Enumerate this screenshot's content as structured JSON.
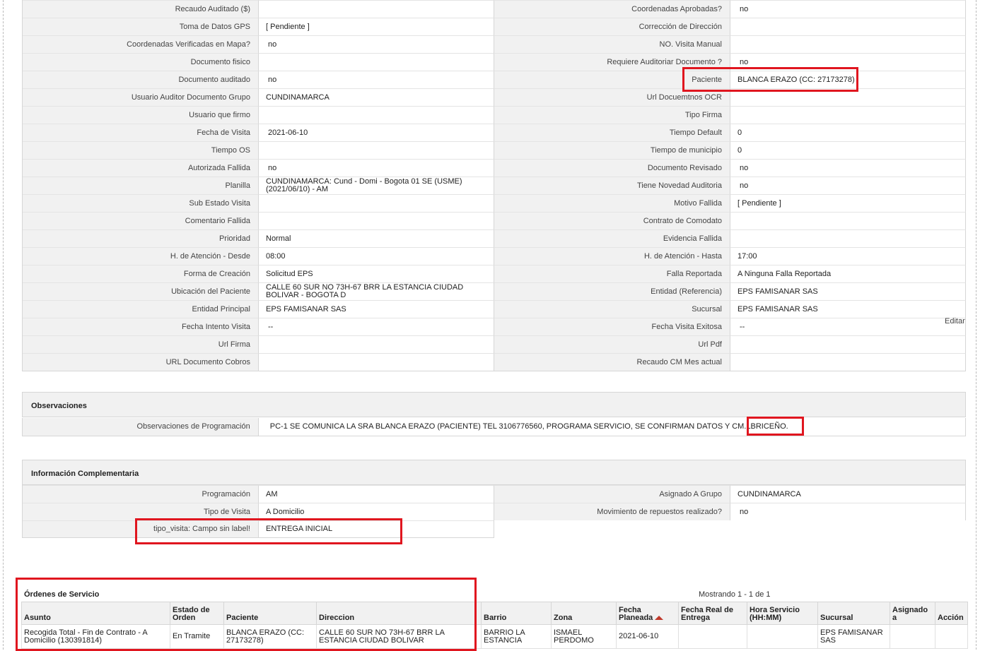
{
  "detail_rows": [
    {
      "l1": "Recaudo Auditado ($)",
      "v1": "",
      "l2": "Coordenadas Aprobadas?",
      "v2": "no"
    },
    {
      "l1": "Toma de Datos GPS",
      "v1": "[ Pendiente ]",
      "l2": "Corrección de Dirección",
      "v2": ""
    },
    {
      "l1": "Coordenadas Verificadas en Mapa?",
      "v1": "no",
      "l2": "NO. Visita Manual",
      "v2": ""
    },
    {
      "l1": "Documento fisico",
      "v1": "",
      "l2": "Requiere Auditoriar Documento ?",
      "v2": "no"
    },
    {
      "l1": "Documento auditado",
      "v1": "no",
      "l2": "Paciente",
      "v2": "BLANCA ERAZO (CC: 27173278)"
    },
    {
      "l1": "Usuario Auditor Documento Grupo",
      "v1": "CUNDINAMARCA",
      "l2": "Url Docuemtnos OCR",
      "v2": ""
    },
    {
      "l1": "Usuario que firmo",
      "v1": "",
      "l2": "Tipo Firma",
      "v2": ""
    },
    {
      "l1": "Fecha de Visita",
      "v1": "2021-06-10",
      "l2": "Tiempo Default",
      "v2": "0"
    },
    {
      "l1": "Tiempo OS",
      "v1": "",
      "l2": "Tiempo de municipio",
      "v2": "0"
    },
    {
      "l1": "Autorizada Fallida",
      "v1": "no",
      "l2": "Documento Revisado",
      "v2": "no"
    },
    {
      "l1": "Planilla",
      "v1": "CUNDINAMARCA: Cund - Domi - Bogota 01 SE (USME) (2021/06/10) - AM",
      "l2": "Tiene Novedad Auditoria",
      "v2": "no"
    },
    {
      "l1": "Sub Estado Visita",
      "v1": "",
      "l2": "Motivo Fallida",
      "v2": "[ Pendiente ]"
    },
    {
      "l1": "Comentario Fallida",
      "v1": "",
      "l2": "Contrato de Comodato",
      "v2": ""
    },
    {
      "l1": "Prioridad",
      "v1": "Normal",
      "l2": "Evidencia Fallida",
      "v2": ""
    },
    {
      "l1": "H. de Atención - Desde",
      "v1": "08:00",
      "l2": "H. de Atención - Hasta",
      "v2": "17:00"
    },
    {
      "l1": "Forma de Creación",
      "v1": "Solicitud EPS",
      "l2": "Falla Reportada",
      "v2": "A Ninguna Falla Reportada"
    },
    {
      "l1": "Ubicación del Paciente",
      "v1": "CALLE 60 SUR NO 73H-67 BRR LA ESTANCIA CIUDAD BOLIVAR - BOGOTA D",
      "l2": "Entidad (Referencia)",
      "v2": "EPS FAMISANAR SAS"
    },
    {
      "l1": "Entidad Principal",
      "v1": "EPS FAMISANAR SAS",
      "l2": "Sucursal",
      "v2": "EPS FAMISANAR SAS"
    },
    {
      "l1": "Fecha Intento Visita",
      "v1": "--",
      "l2": "Fecha Visita Exitosa",
      "v2": "--"
    },
    {
      "l1": "Url Firma",
      "v1": "",
      "l2": "Url Pdf",
      "v2": ""
    },
    {
      "l1": "URL Documento Cobros",
      "v1": "",
      "l2": "Recaudo CM Mes actual",
      "v2": ""
    }
  ],
  "edit_label": "Editar",
  "observaciones": {
    "title": "Observaciones",
    "label": "Observaciones de Programación",
    "value": "PC-1 SE COMUNICA LA SRA BLANCA ERAZO (PACIENTE) TEL 3106776560, PROGRAMA SERVICIO, SE CONFIRMAN DATOS Y CM.LBRICEÑO."
  },
  "complementaria": {
    "title": "Información Complementaria",
    "rows": [
      {
        "l1": "Programación",
        "v1": "AM",
        "l2": "Asignado A Grupo",
        "v2": "CUNDINAMARCA"
      },
      {
        "l1": "Tipo de Visita",
        "v1": "A Domicilio",
        "l2": "Movimiento de repuestos realizado?",
        "v2": "no"
      }
    ],
    "last_row": {
      "l1": "tipo_visita: Campo sin label!",
      "v1": "ENTREGA INICIAL"
    }
  },
  "ordenes": {
    "title": "Órdenes de Servicio",
    "count": "Mostrando 1 - 1 de 1",
    "headers": [
      "Asunto",
      "Estado de Orden",
      "Paciente",
      "Direccion",
      "Barrio",
      "Zona",
      "Fecha Planeada",
      "Fecha Real de Entrega",
      "Hora Servicio (HH:MM)",
      "Sucursal",
      "Asignado a",
      "Acción"
    ],
    "rows": [
      [
        "Recogida Total - Fin de Contrato - A Domicilio (130391814)",
        "En Tramite",
        "BLANCA ERAZO (CC: 27173278)",
        "CALLE 60 SUR NO 73H-67 BRR LA ESTANCIA CIUDAD BOLIVAR",
        "BARRIO LA ESTANCIA",
        "ISMAEL PERDOMO",
        "2021-06-10",
        "",
        "",
        "EPS FAMISANAR SAS",
        "",
        ""
      ]
    ]
  },
  "colors": {
    "highlight": "#e0161f",
    "sort_arrow": "#c0392b",
    "label_bg": "#f1f1f1"
  },
  "icons": {
    "sort": "sort-ascending-icon"
  }
}
